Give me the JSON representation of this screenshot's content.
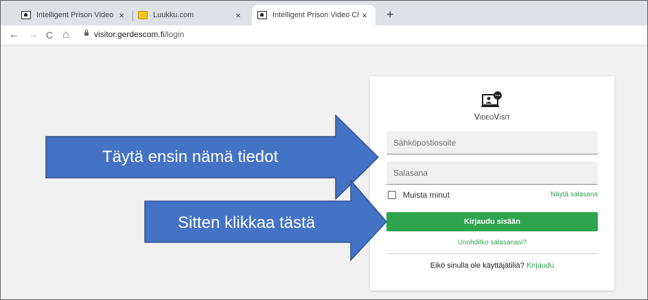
{
  "browser": {
    "tabs": [
      {
        "title": "Intelligent Prison Video Chat",
        "close": "×"
      },
      {
        "title": "Luukku.com",
        "close": "×"
      },
      {
        "title": "Intelligent Prison Video Chat",
        "close": "×"
      }
    ],
    "new_tab": "+",
    "nav": {
      "back": "←",
      "forward": "→",
      "reload": "C",
      "home": "⌂"
    },
    "url_host": "visitor.gerdescom.fi",
    "url_path": "/login"
  },
  "login": {
    "brand": "VideoVisit",
    "email_placeholder": "Sähköpostiosoite",
    "password_placeholder": "Salasana",
    "remember_label": "Muista minut",
    "show_password": "Näytä salasana",
    "login_button": "Kirjaudu sisään",
    "forgot_password": "Unohditko salasanasi?",
    "no_account": "Eikö sinulla ole käyttäjätiliä?",
    "signup_link": "Kirjaudu"
  },
  "annotations": {
    "arrow1_text": "Täytä ensin nämä tiedot",
    "arrow2_text": "Sitten klikkaa tästä"
  },
  "colors": {
    "accent": "#2ea44f",
    "arrow_fill": "#4472c4",
    "arrow_stroke": "#2f528f"
  }
}
